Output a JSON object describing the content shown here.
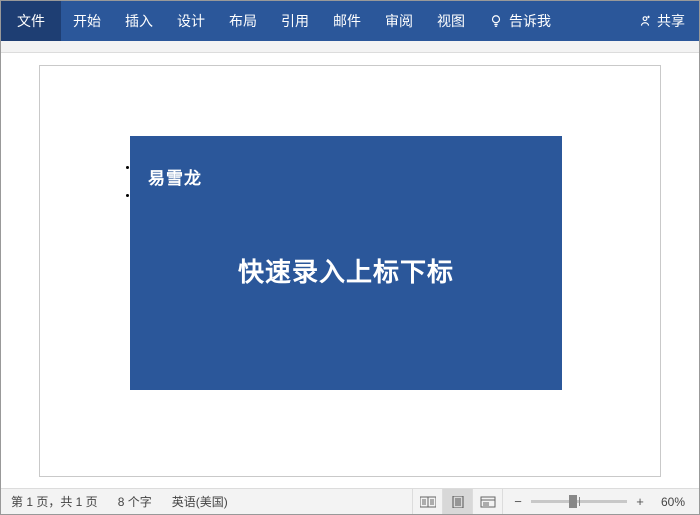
{
  "ribbon": {
    "file": "文件",
    "tabs": [
      "开始",
      "插入",
      "设计",
      "布局",
      "引用",
      "邮件",
      "审阅",
      "视图"
    ],
    "tell_me": "告诉我",
    "share": "共享"
  },
  "document": {
    "cover_author": "易雪龙",
    "cover_title": "快速录入上标下标"
  },
  "statusbar": {
    "page_info": "第 1 页，共 1 页",
    "word_count": "8 个字",
    "language": "英语(美国)",
    "zoom_percent": "60%"
  }
}
